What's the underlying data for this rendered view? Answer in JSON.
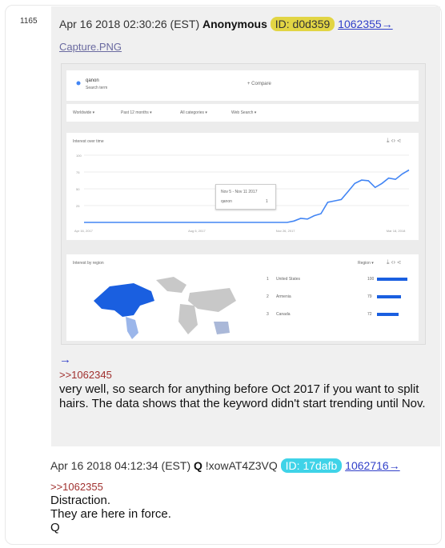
{
  "thread": {
    "post_number": "1165"
  },
  "post1": {
    "timestamp": "Apr 16 2018 02:30:26 (EST)",
    "author": "Anonymous",
    "id": "ID: d0d359",
    "reply_link": "1062355→",
    "filename": "Capture.PNG",
    "arrow": "→",
    "quote": ">>1062345",
    "body": "very well, so search for anything before Oct 2017 if you want to split hairs. The data shows that the keyword didn't start trending until Nov."
  },
  "post2": {
    "timestamp": "Apr 16 2018 04:12:34 (EST)",
    "author": "Q",
    "tripcode": "!xowAT4Z3VQ",
    "id": "ID: 17dafb",
    "reply_link": "1062716→",
    "quote": ">>1062355",
    "body_lines": [
      "Distraction.",
      "They are here in force.",
      "Q"
    ]
  },
  "screenshot": {
    "search_term": "qanon",
    "search_sub": "Search term",
    "compare": "+ Compare",
    "filters": [
      "Worldwide ▾",
      "Past 12 months ▾",
      "All categories ▾",
      "Web Search ▾"
    ],
    "panel_title": "Interest over time",
    "tooltip_date": "Nov 5 - Nov 11 2017",
    "tooltip_term": "qanon",
    "tooltip_value": "1",
    "x_ticks": [
      "Apr 16, 2017",
      "Aug 6, 2017",
      "Nov 26, 2017",
      "Mar 18, 2018"
    ],
    "y_ticks": [
      "100",
      "75",
      "50",
      "25"
    ],
    "region_title": "Interest by region",
    "region_control": "Region ▾",
    "regions": [
      {
        "rank": "1",
        "name": "United States",
        "value": 100,
        "label": "100"
      },
      {
        "rank": "2",
        "name": "Armenia",
        "value": 79,
        "label": "79"
      },
      {
        "rank": "3",
        "name": "Canada",
        "value": 72,
        "label": "72"
      }
    ],
    "series_color": "#4285f4",
    "chart_data": {
      "type": "line",
      "x": [
        "Apr 16, 2017",
        "Aug 6, 2017",
        "Nov 26, 2017",
        "Mar 18, 2018"
      ],
      "values": [
        0,
        0,
        0,
        0,
        0,
        0,
        0,
        0,
        0,
        0,
        0,
        0,
        0,
        0,
        0,
        0,
        0,
        0,
        0,
        0,
        0,
        0,
        0,
        0,
        0,
        0,
        0,
        0,
        0,
        0,
        0,
        2,
        6,
        5,
        10,
        13,
        30,
        32,
        34,
        46,
        58,
        63,
        62,
        52,
        58,
        66,
        64,
        72,
        78
      ],
      "ylim": [
        0,
        100
      ]
    }
  }
}
